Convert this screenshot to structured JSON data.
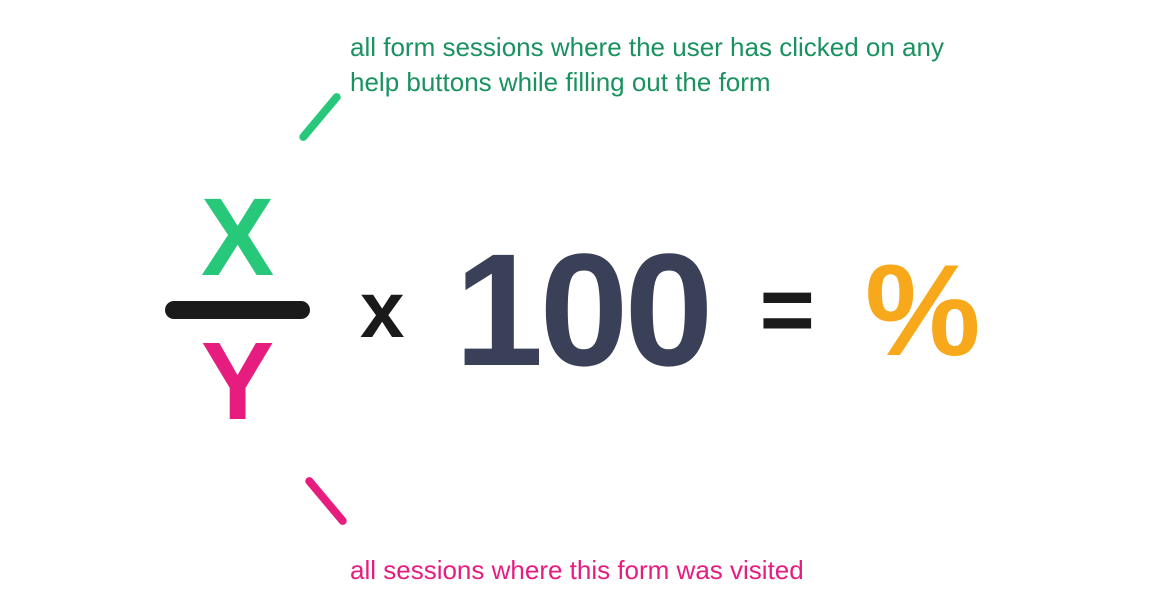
{
  "annotations": {
    "numerator_desc": "all form sessions where the user has clicked on any help buttons while filling out the form",
    "denominator_desc": "all sessions where this form was visited"
  },
  "formula": {
    "numerator": "X",
    "denominator": "Y",
    "multiply": "x",
    "constant": "100",
    "equals": "=",
    "result": "%"
  },
  "colors": {
    "numerator": "#28c87a",
    "denominator": "#e61d7e",
    "constant": "#3a4057",
    "result": "#f7a81b",
    "annotation_top": "#1a9260"
  }
}
